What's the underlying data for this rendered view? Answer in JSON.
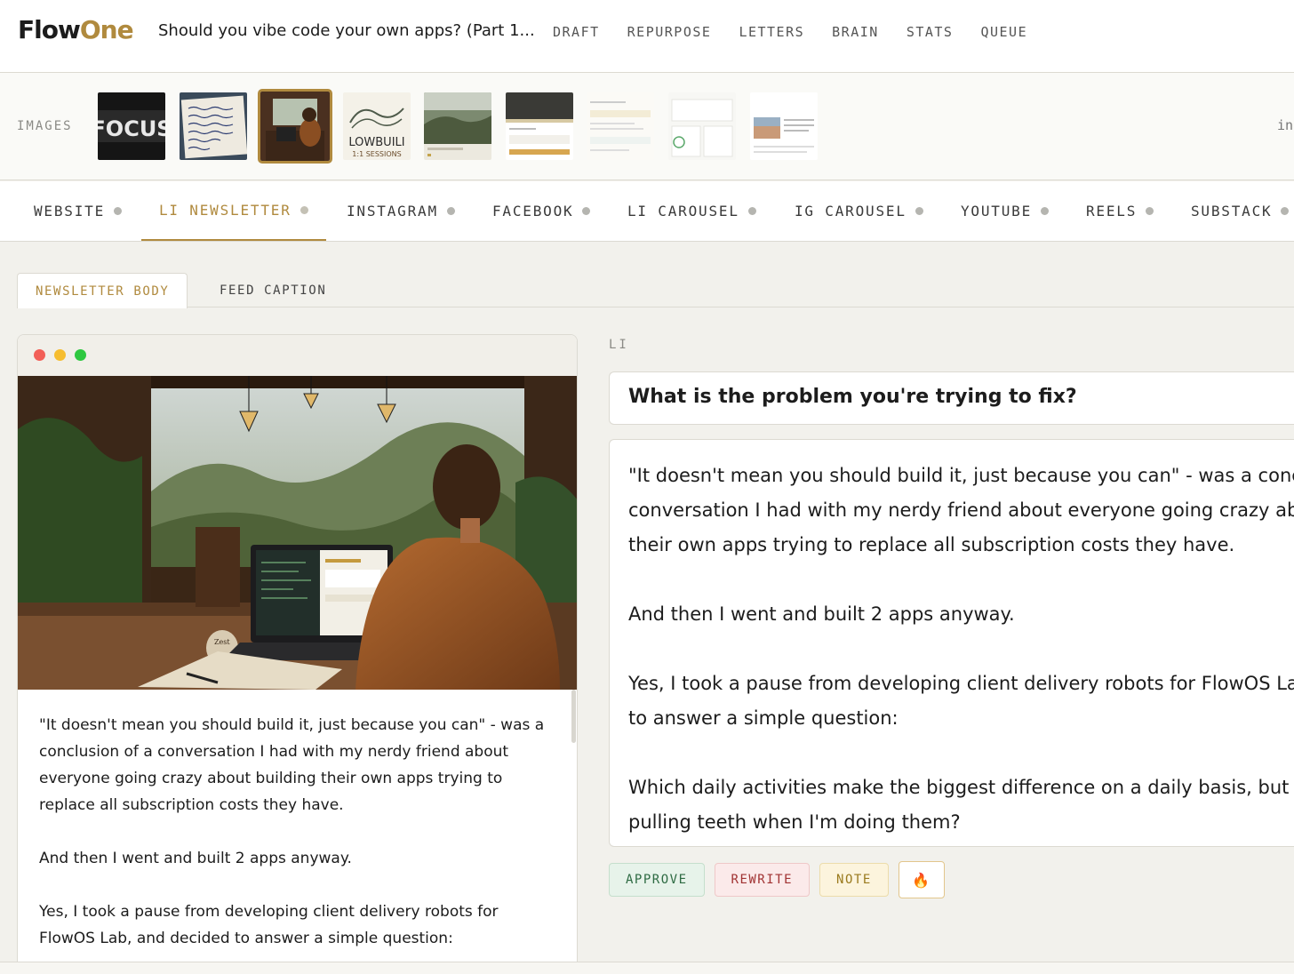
{
  "header": {
    "logo_part1": "Flow",
    "logo_part2": "One",
    "doc_title": "Should you vibe code your own apps? (Part 1...",
    "nav": [
      "DRAFT",
      "REPURPOSE",
      "LETTERS",
      "BRAIN",
      "STATS",
      "QUEUE"
    ]
  },
  "images": {
    "label": "IMAGES",
    "right_text": "in",
    "thumbnails": [
      "focus-image",
      "handwritten-note-image",
      "cafe-laptop-image",
      "lowbuild-logo-image",
      "landscape-image",
      "dashboard-screenshot-image",
      "document-screenshot-image",
      "stats-screenshot-image",
      "article-screenshot-image"
    ],
    "thumb_text": {
      "focus": "FOCUS",
      "lowbuild": "LOWBUILI",
      "lowbuild_sub": "1:1 SESSIONS"
    },
    "selected_index": 2
  },
  "platform_tabs": [
    {
      "label": "WEBSITE"
    },
    {
      "label": "LI NEWSLETTER"
    },
    {
      "label": "INSTAGRAM"
    },
    {
      "label": "FACEBOOK"
    },
    {
      "label": "LI CAROUSEL"
    },
    {
      "label": "IG CAROUSEL"
    },
    {
      "label": "YOUTUBE"
    },
    {
      "label": "REELS"
    },
    {
      "label": "SUBSTACK"
    }
  ],
  "active_platform": "LI NEWSLETTER",
  "sub_tabs": {
    "body": "NEWSLETTER BODY",
    "caption": "FEED CAPTION"
  },
  "preview": {
    "paragraphs": [
      "\"It doesn't mean you should build it, just because you can\" - was a conclusion of a conversation I had with my nerdy friend about everyone going crazy about building their own apps trying to replace all subscription costs they have.",
      "And then I went and built 2 apps anyway.",
      "Yes, I took a pause from developing client delivery robots for FlowOS Lab, and decided to answer a simple question:"
    ],
    "mug_text": "Zest"
  },
  "editor": {
    "section_label": "LI",
    "title": "What is the problem you're trying to fix?",
    "body_lines": [
      [
        "\"It doesn't mean you should build it, just because you can\" - was a conc",
        "conversation I had with my nerdy friend about everyone going crazy ab",
        "their own apps trying to replace all subscription costs they have."
      ],
      [
        "And then I went and built 2 apps anyway."
      ],
      [
        "Yes, I took a pause from developing client delivery robots for FlowOS La",
        "to answer a simple question:"
      ],
      [
        "Which daily activities make the biggest difference on a daily basis, but",
        "pulling teeth when I'm doing them?"
      ]
    ]
  },
  "actions": {
    "approve": "APPROVE",
    "rewrite": "REWRITE",
    "note": "NOTE",
    "fire": "🔥"
  },
  "colors": {
    "accent": "#b08a3e",
    "background": "#f2f1ec",
    "approve": "#2e6b43",
    "rewrite": "#a13333",
    "note": "#9a7a1e"
  }
}
